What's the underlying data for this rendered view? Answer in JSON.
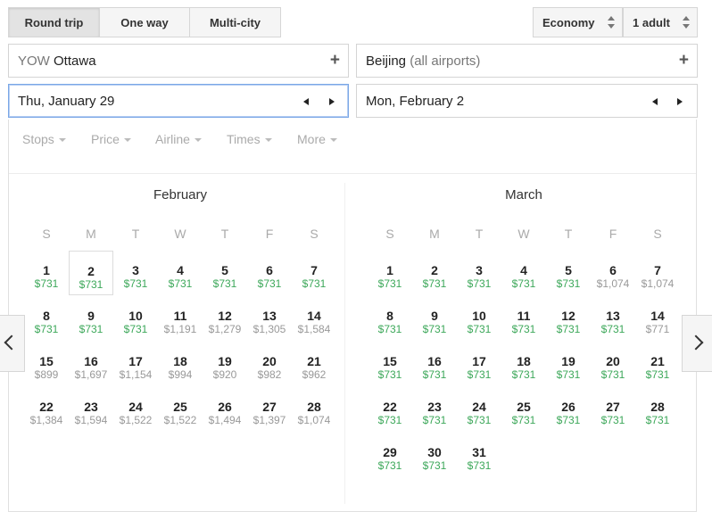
{
  "trip_types": [
    {
      "label": "Round trip",
      "active": true
    },
    {
      "label": "One way",
      "active": false
    },
    {
      "label": "Multi-city",
      "active": false
    }
  ],
  "cabin": "Economy",
  "passengers": "1 adult",
  "origin": {
    "code": "YOW",
    "city": "Ottawa"
  },
  "destination": {
    "city": "Beijing",
    "qualifier": "(all airports)"
  },
  "depart_date": "Thu, January 29",
  "return_date": "Mon, February 2",
  "filters": [
    "Stops",
    "Price",
    "Airline",
    "Times",
    "More"
  ],
  "weekdays": [
    "S",
    "M",
    "T",
    "W",
    "T",
    "F",
    "S"
  ],
  "months": [
    {
      "name": "February",
      "start_weekday": 0,
      "days": [
        {
          "d": "1",
          "p": "$731",
          "low": true
        },
        {
          "d": "2",
          "p": "$731",
          "low": true,
          "selected": true
        },
        {
          "d": "3",
          "p": "$731",
          "low": true
        },
        {
          "d": "4",
          "p": "$731",
          "low": true
        },
        {
          "d": "5",
          "p": "$731",
          "low": true
        },
        {
          "d": "6",
          "p": "$731",
          "low": true
        },
        {
          "d": "7",
          "p": "$731",
          "low": true
        },
        {
          "d": "8",
          "p": "$731",
          "low": true
        },
        {
          "d": "9",
          "p": "$731",
          "low": true
        },
        {
          "d": "10",
          "p": "$731",
          "low": true
        },
        {
          "d": "11",
          "p": "$1,191",
          "low": false
        },
        {
          "d": "12",
          "p": "$1,279",
          "low": false
        },
        {
          "d": "13",
          "p": "$1,305",
          "low": false
        },
        {
          "d": "14",
          "p": "$1,584",
          "low": false
        },
        {
          "d": "15",
          "p": "$899",
          "low": false
        },
        {
          "d": "16",
          "p": "$1,697",
          "low": false
        },
        {
          "d": "17",
          "p": "$1,154",
          "low": false
        },
        {
          "d": "18",
          "p": "$994",
          "low": false
        },
        {
          "d": "19",
          "p": "$920",
          "low": false
        },
        {
          "d": "20",
          "p": "$982",
          "low": false
        },
        {
          "d": "21",
          "p": "$962",
          "low": false
        },
        {
          "d": "22",
          "p": "$1,384",
          "low": false
        },
        {
          "d": "23",
          "p": "$1,594",
          "low": false
        },
        {
          "d": "24",
          "p": "$1,522",
          "low": false
        },
        {
          "d": "25",
          "p": "$1,522",
          "low": false
        },
        {
          "d": "26",
          "p": "$1,494",
          "low": false
        },
        {
          "d": "27",
          "p": "$1,397",
          "low": false
        },
        {
          "d": "28",
          "p": "$1,074",
          "low": false
        }
      ]
    },
    {
      "name": "March",
      "start_weekday": 0,
      "days": [
        {
          "d": "1",
          "p": "$731",
          "low": true
        },
        {
          "d": "2",
          "p": "$731",
          "low": true
        },
        {
          "d": "3",
          "p": "$731",
          "low": true
        },
        {
          "d": "4",
          "p": "$731",
          "low": true
        },
        {
          "d": "5",
          "p": "$731",
          "low": true
        },
        {
          "d": "6",
          "p": "$1,074",
          "low": false
        },
        {
          "d": "7",
          "p": "$1,074",
          "low": false
        },
        {
          "d": "8",
          "p": "$731",
          "low": true
        },
        {
          "d": "9",
          "p": "$731",
          "low": true
        },
        {
          "d": "10",
          "p": "$731",
          "low": true
        },
        {
          "d": "11",
          "p": "$731",
          "low": true
        },
        {
          "d": "12",
          "p": "$731",
          "low": true
        },
        {
          "d": "13",
          "p": "$731",
          "low": true
        },
        {
          "d": "14",
          "p": "$771",
          "low": false
        },
        {
          "d": "15",
          "p": "$731",
          "low": true
        },
        {
          "d": "16",
          "p": "$731",
          "low": true
        },
        {
          "d": "17",
          "p": "$731",
          "low": true
        },
        {
          "d": "18",
          "p": "$731",
          "low": true
        },
        {
          "d": "19",
          "p": "$731",
          "low": true
        },
        {
          "d": "20",
          "p": "$731",
          "low": true
        },
        {
          "d": "21",
          "p": "$731",
          "low": true
        },
        {
          "d": "22",
          "p": "$731",
          "low": true
        },
        {
          "d": "23",
          "p": "$731",
          "low": true
        },
        {
          "d": "24",
          "p": "$731",
          "low": true
        },
        {
          "d": "25",
          "p": "$731",
          "low": true
        },
        {
          "d": "26",
          "p": "$731",
          "low": true
        },
        {
          "d": "27",
          "p": "$731",
          "low": true
        },
        {
          "d": "28",
          "p": "$731",
          "low": true
        },
        {
          "d": "29",
          "p": "$731",
          "low": true
        },
        {
          "d": "30",
          "p": "$731",
          "low": true
        },
        {
          "d": "31",
          "p": "$731",
          "low": true
        }
      ]
    }
  ],
  "icons": {
    "add_origin": "plus-icon",
    "add_destination": "plus-icon",
    "prev_day": "triangle-left-icon",
    "next_day": "triangle-right-icon",
    "prev_month": "chevron-left-icon",
    "next_month": "chevron-right-icon",
    "select_arrows": "up-down-arrows-icon"
  },
  "colors": {
    "low_price": "#3da85a",
    "regular_price": "#999999",
    "focus_border": "#7aa7e6"
  }
}
